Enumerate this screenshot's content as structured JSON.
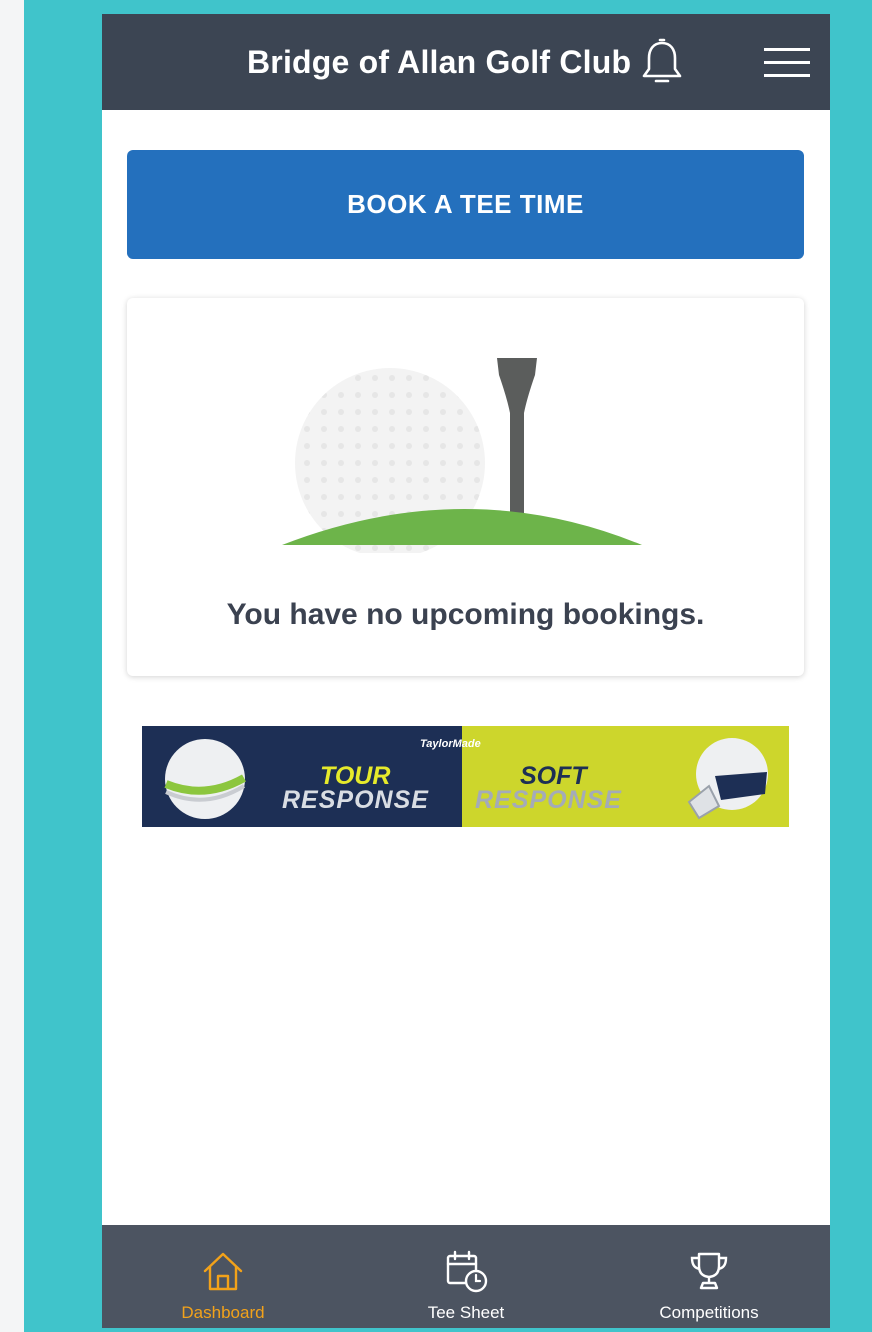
{
  "header": {
    "title": "Bridge of Allan Golf Club",
    "notification_icon": "bell-icon",
    "menu_icon": "hamburger-menu-icon"
  },
  "book_button": {
    "label": "BOOK A TEE TIME"
  },
  "bookings_card": {
    "illustration_icon": "golf-ball-on-tee-icon",
    "message": "You have no upcoming bookings."
  },
  "banner": {
    "brand": "TaylorMade",
    "left_line1": "TOUR",
    "left_line2": "RESPONSE",
    "right_line1": "SOFT",
    "right_line2": "RESPONSE"
  },
  "tabs": [
    {
      "label": "Dashboard",
      "icon": "home-icon",
      "active": true
    },
    {
      "label": "Tee Sheet",
      "icon": "calendar-clock-icon",
      "active": false
    },
    {
      "label": "Competitions",
      "icon": "trophy-icon",
      "active": false
    }
  ],
  "colors": {
    "frame": "#40c4cb",
    "header": "#3c4553",
    "primary": "#2470bd",
    "tabbar": "#4c5461",
    "active_tab": "#f2a21a"
  }
}
